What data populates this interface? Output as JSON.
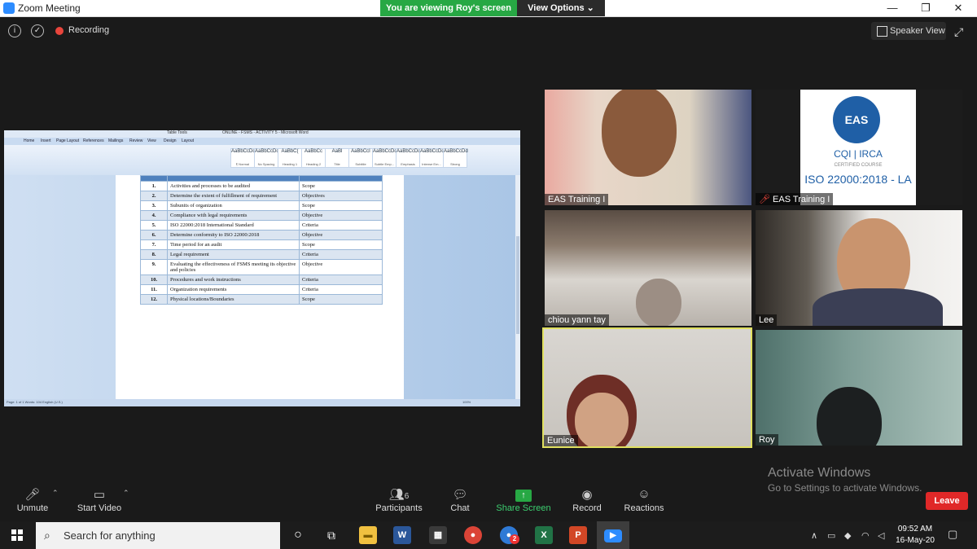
{
  "window": {
    "title": "Zoom Meeting",
    "minimize": "—",
    "maximize": "❐",
    "close": "✕"
  },
  "viewing_banner": "You are viewing Roy's screen",
  "view_options": "View Options ⌄",
  "meeting_bar": {
    "recording": "Recording",
    "speaker_view": "Speaker View"
  },
  "shared_doc": {
    "table_tools": "Table Tools",
    "doc_title": "ONLINE - FSMS - ACTIVITY 5 - Microsoft Word",
    "ribbon_tabs": [
      "Home",
      "Insert",
      "Page Layout",
      "References",
      "Mailings",
      "Review",
      "View",
      "Design",
      "Layout"
    ],
    "styles": [
      {
        "sample": "AaBbCcDc",
        "name": "¶ Normal"
      },
      {
        "sample": "AaBbCcDc",
        "name": "No Spacing"
      },
      {
        "sample": "AaBbC(",
        "name": "Heading 1"
      },
      {
        "sample": "AaBbCc",
        "name": "Heading 2"
      },
      {
        "sample": "AaBl",
        "name": "Title"
      },
      {
        "sample": "AaBbCcI",
        "name": "Subtitle"
      },
      {
        "sample": "AaBbCcDd",
        "name": "Subtle Emp..."
      },
      {
        "sample": "AaBbCcDd",
        "name": "Emphasis"
      },
      {
        "sample": "AaBbCcDd",
        "name": "Intense Em..."
      },
      {
        "sample": "AaBbCcDd",
        "name": "Strong"
      }
    ],
    "status_left": "Page: 1 of 1    Words: 104    English (U.S.)",
    "status_zoom": "100%",
    "rows": [
      {
        "n": "1.",
        "activity": "Activities and processes to be audited",
        "category": "Scope"
      },
      {
        "n": "2.",
        "activity": "Determine the extent of fulfillment of requirement",
        "category": "Objectives"
      },
      {
        "n": "3.",
        "activity": "Subunits of organization",
        "category": "Scope"
      },
      {
        "n": "4.",
        "activity": "Compliance with legal requirements",
        "category": "Objective"
      },
      {
        "n": "5.",
        "activity": "ISO 22000:2018 International Standard",
        "category": "Criteria"
      },
      {
        "n": "6.",
        "activity": "Determine conformity to ISO 22000:2018",
        "category": "Objective"
      },
      {
        "n": "7.",
        "activity": "Time period for an audit",
        "category": "Scope"
      },
      {
        "n": "8.",
        "activity": "Legal requirement",
        "category": "Criteria"
      },
      {
        "n": "9.",
        "activity": "Evaluating the effectiveness of FSMS meeting its objective and policies",
        "category": "Objective"
      },
      {
        "n": "10.",
        "activity": "Procedures and work instructions",
        "category": "Criteria"
      },
      {
        "n": "11.",
        "activity": "Organization requirements",
        "category": "Criteria"
      },
      {
        "n": "12.",
        "activity": "Physical locations/Boundaries",
        "category": "Scope"
      }
    ]
  },
  "participants": [
    {
      "name": "EAS Training I"
    },
    {
      "name": "EAS Training I"
    },
    {
      "name": "chiou yann tay"
    },
    {
      "name": "Lee"
    },
    {
      "name": "Eunice"
    },
    {
      "name": "Roy"
    }
  ],
  "eas_card": {
    "logo": "EAS",
    "cqi": "CQI | IRCA",
    "certified": "CERTIFIED COURSE",
    "iso": "ISO 22000:2018 - LA"
  },
  "activate": {
    "line1": "Activate Windows",
    "line2": "Go to Settings to activate Windows."
  },
  "toolbar": {
    "unmute": "Unmute",
    "start_video": "Start Video",
    "participants": "Participants",
    "participants_count": "6",
    "chat": "Chat",
    "share_screen": "Share Screen",
    "record": "Record",
    "reactions": "Reactions",
    "leave": "Leave"
  },
  "taskbar": {
    "search_placeholder": "Search for anything",
    "time": "09:52 AM",
    "date": "16-May-20",
    "chrome_badge": "2"
  },
  "colors": {
    "share_green": "#27a844",
    "leave_red": "#e02828",
    "active_speaker": "#e0e060",
    "zoom_blue": "#2d8cff"
  }
}
